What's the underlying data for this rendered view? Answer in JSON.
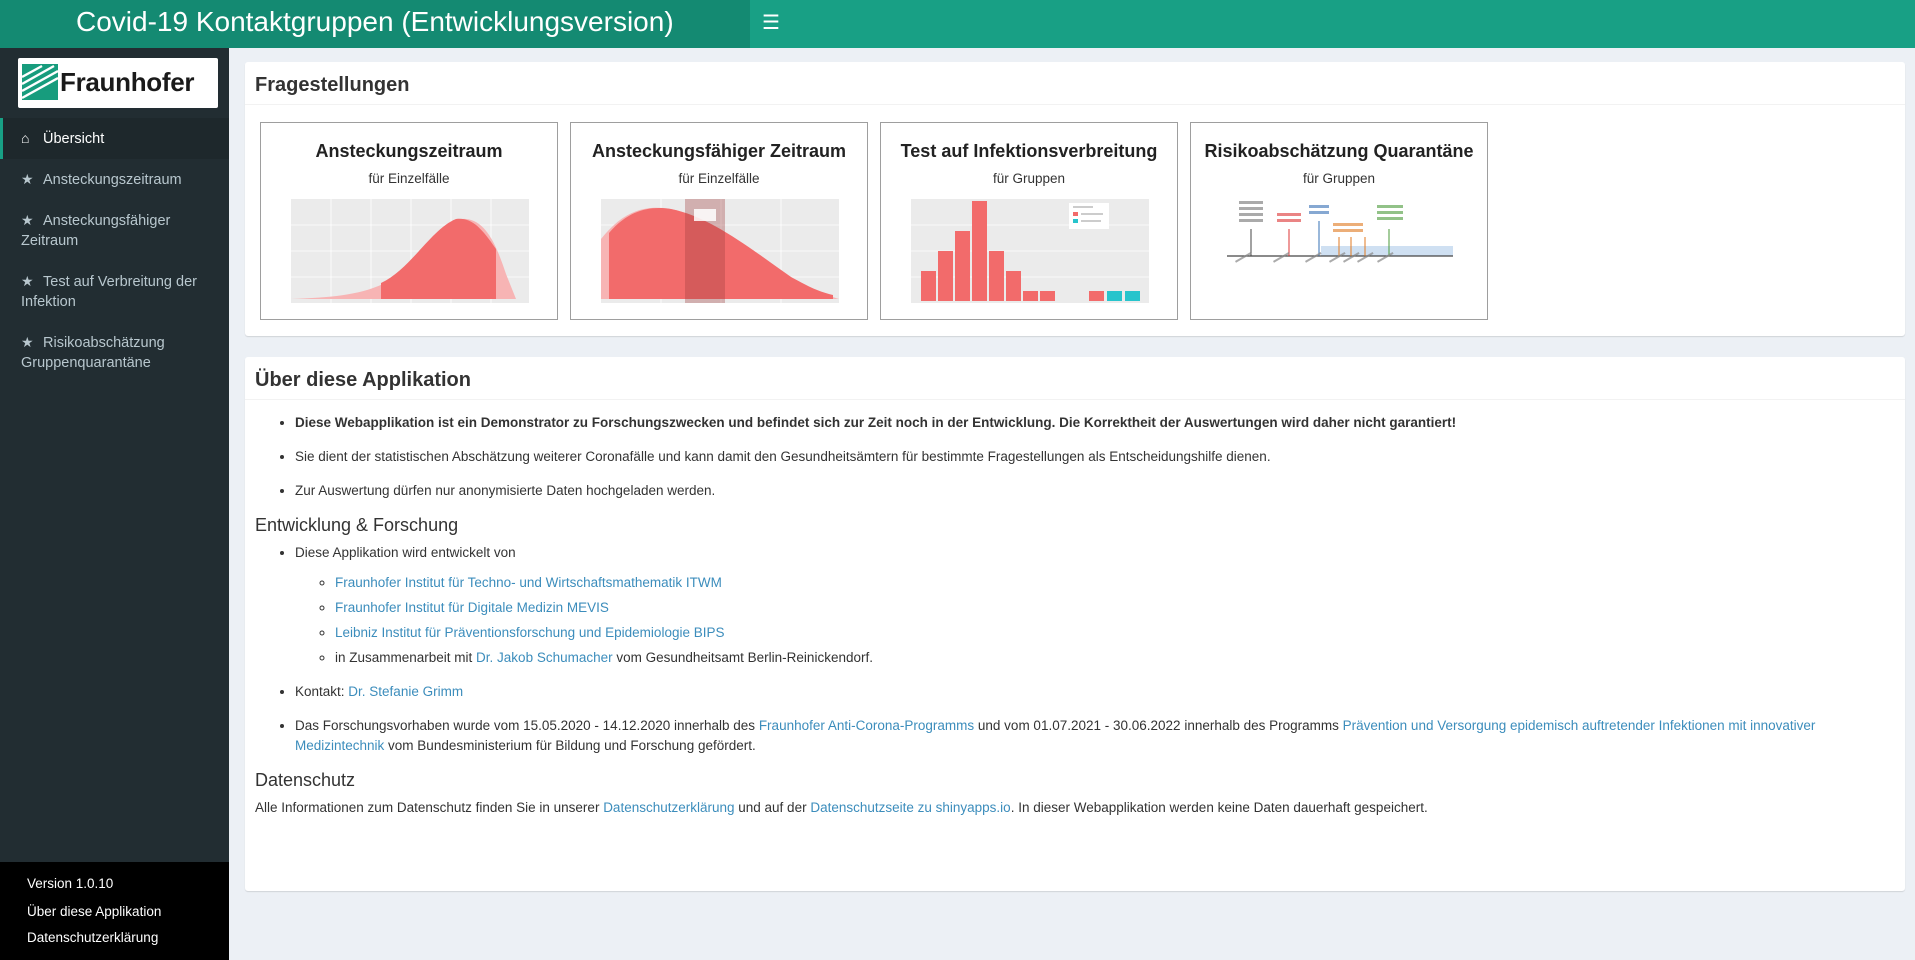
{
  "header": {
    "title": "Covid-19 Kontaktgruppen (Entwicklungsversion)",
    "menu_icon": "hamburger-icon",
    "color": "#18a085",
    "logo_bg": "#148a72"
  },
  "sidebar": {
    "brand": "Fraunhofer",
    "items": [
      {
        "label": "Übersicht",
        "icon": "home-icon",
        "active": true
      },
      {
        "label": "Ansteckungszeitraum",
        "icon": "star-icon"
      },
      {
        "label": "Ansteckungsfähiger\nZeitraum",
        "icon": "star-icon"
      },
      {
        "label": "Test auf Verbreitung der\nInfektion",
        "icon": "star-icon"
      },
      {
        "label": "Risikoabschätzung\nGruppenquarantäne",
        "icon": "star-icon"
      }
    ],
    "footer": {
      "version": "Version 1.0.10",
      "about_link": "Über diese Applikation",
      "privacy_link": "Datenschutzerklärung"
    }
  },
  "questions": {
    "title": "Fragestellungen",
    "cards": [
      {
        "title": "Ansteckungszeitraum",
        "subtitle": "für Einzelfälle"
      },
      {
        "title": "Ansteckungsfähiger Zeitraum",
        "subtitle": "für Einzelfälle"
      },
      {
        "title": "Test auf Infektionsverbreitung",
        "subtitle": "für Gruppen"
      },
      {
        "title": "Risikoabschätzung Quarantäne",
        "subtitle": "für Gruppen"
      }
    ]
  },
  "about": {
    "title": "Über diese Applikation",
    "bullet1": "Diese Webapplikation ist ein Demonstrator zu Forschungszwecken und befindet sich zur Zeit noch in der Entwicklung. Die Korrektheit der Auswertungen wird daher nicht garantiert!",
    "bullet2": "Sie dient der statistischen Abschätzung weiterer Coronafälle und kann damit den Gesundheitsämtern für bestimmte Fragestellungen als Entscheidungshilfe dienen.",
    "bullet3": "Zur Auswertung dürfen nur anonymisierte Daten hochgeladen werden.",
    "dev_heading": "Entwicklung & Forschung",
    "dev_intro": "Diese Applikation wird entwickelt von",
    "inst1": "Fraunhofer Institut für Techno- und Wirtschaftsmathematik ITWM",
    "inst2": "Fraunhofer Institut für Digitale Medizin MEVIS",
    "inst3": "Leibniz Institut für Präventionsforschung und Epidemiologie BIPS",
    "collab_pre": "in Zusammenarbeit mit ",
    "collab_link": "Dr. Jakob Schumacher",
    "collab_post": " vom Gesundheitsamt Berlin-Reinickendorf.",
    "contact_pre": "Kontakt: ",
    "contact_link": "Dr. Stefanie Grimm",
    "funding_pre": "Das Forschungsvorhaben wurde vom 15.05.2020 - 14.12.2020 innerhalb des ",
    "funding_link1": "Fraunhofer Anti-Corona-Programms",
    "funding_mid": " und vom 01.07.2021 - 30.06.2022 innerhalb des Programms ",
    "funding_link2": "Prävention und Versorgung epidemisch auftretender Infektionen mit innovativer Medizintechnik",
    "funding_post": " vom Bundesministerium für Bildung und Forschung gefördert.",
    "privacy_heading": "Datenschutz",
    "privacy_pre": "Alle Informationen zum Datenschutz finden Sie in unserer ",
    "privacy_link1": "Datenschutzerklärung",
    "privacy_mid": " und auf der ",
    "privacy_link2": "Datenschutzseite zu shinyapps.io",
    "privacy_post": ". In dieser Webapplikation werden keine Daten dauerhaft gespeichert."
  }
}
